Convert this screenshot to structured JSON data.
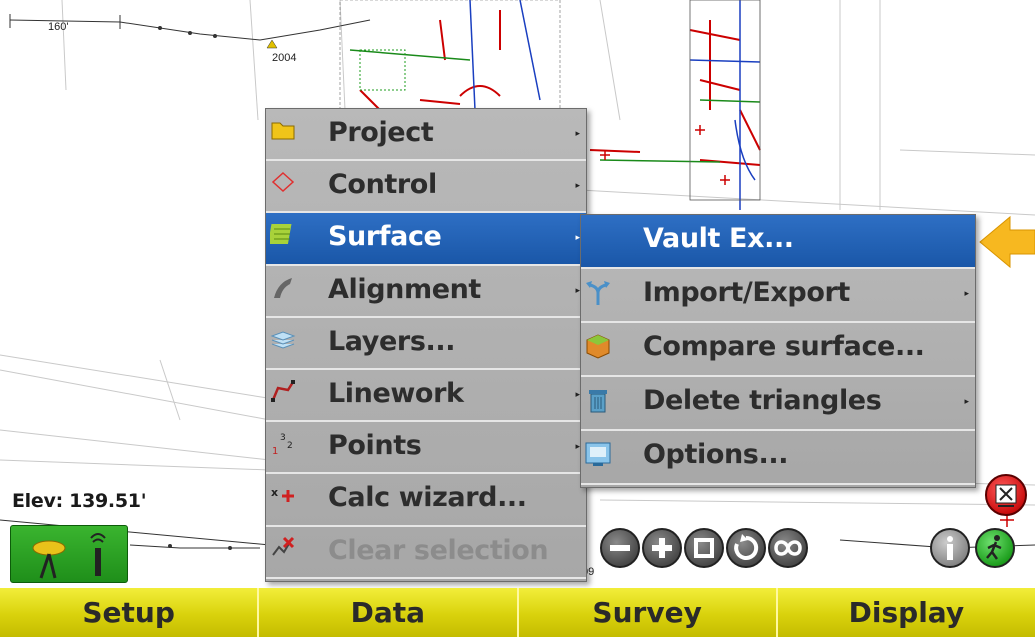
{
  "map": {
    "scale_label": "160'",
    "point_label": "2004",
    "partial_label": "09",
    "elevation": "Elev: 139.51'"
  },
  "main_menu": {
    "items": [
      {
        "label": "Project",
        "icon": "folder-icon",
        "submenu": true
      },
      {
        "label": "Control",
        "icon": "control-diamond-icon",
        "submenu": true
      },
      {
        "label": "Surface",
        "icon": "surface-icon",
        "submenu": true,
        "selected": true
      },
      {
        "label": "Alignment",
        "icon": "alignment-icon",
        "submenu": true
      },
      {
        "label": "Layers...",
        "icon": "layers-icon",
        "submenu": false
      },
      {
        "label": "Linework",
        "icon": "linework-icon",
        "submenu": true
      },
      {
        "label": "Points",
        "icon": "points-icon",
        "submenu": true
      },
      {
        "label": "Calc wizard...",
        "icon": "calc-wizard-icon",
        "submenu": false
      },
      {
        "label": "Clear selection",
        "icon": "clear-selection-icon",
        "submenu": false,
        "disabled": true
      }
    ]
  },
  "surface_submenu": {
    "items": [
      {
        "label": "Vault Ex...",
        "icon": "",
        "submenu": false,
        "selected": true
      },
      {
        "label": "Import/Export",
        "icon": "import-export-icon",
        "submenu": true
      },
      {
        "label": "Compare surface...",
        "icon": "compare-surface-icon",
        "submenu": false
      },
      {
        "label": "Delete triangles",
        "icon": "trash-icon",
        "submenu": true
      },
      {
        "label": "Options...",
        "icon": "options-icon",
        "submenu": false
      }
    ]
  },
  "toolbar": {
    "zoom_out": "minus-icon",
    "zoom_in": "plus-icon",
    "zoom_extents": "square-icon",
    "rotate": "rotate-icon",
    "infinity": "infinity-icon",
    "info": "info-icon",
    "walk": "walk-icon",
    "exit": "exit-icon"
  },
  "bottom_tabs": [
    "Setup",
    "Data",
    "Survey",
    "Display"
  ],
  "colors": {
    "menu_bg": "#b0b0b0",
    "selection": "#1f5fb0",
    "tab_yellow": "#d9d20c",
    "pointer_arrow": "#f5b623"
  }
}
